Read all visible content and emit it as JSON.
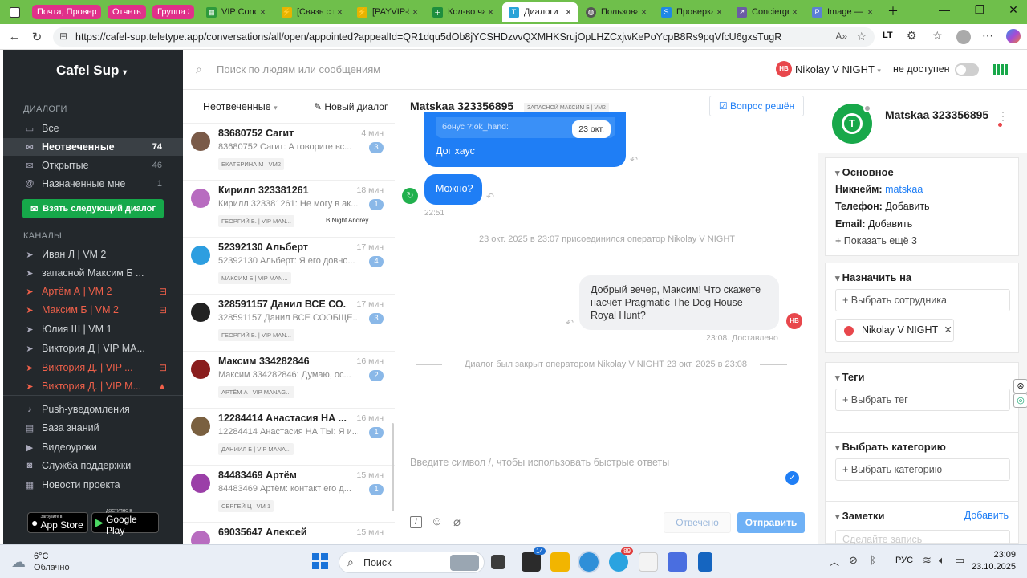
{
  "browser": {
    "tab_groups": [
      {
        "label": "Почта, Проверк",
        "color": "#e0318a"
      },
      {
        "label": "Отчеты",
        "color": "#e0318a"
      },
      {
        "label": "Группа 3",
        "color": "#e0318a"
      }
    ],
    "tabs": [
      {
        "label": "VIP Concie"
      },
      {
        "label": "[Связь с к"
      },
      {
        "label": "[PAYVIP-5"
      },
      {
        "label": "Кол-во ча"
      },
      {
        "label": "Диалоги",
        "active": true
      },
      {
        "label": "Пользова"
      },
      {
        "label": "Проверка"
      },
      {
        "label": "Concierge"
      },
      {
        "label": "Image —"
      }
    ],
    "url": "https://cafel-sup.teletype.app/conversations/all/open/appointed?appealId=QR1dqu5dOb8jYCSHDzvvQXMHKSrujOpLHZCxjwKePoYcpB8Rs9pqVfcU6gxsTugR"
  },
  "sidebar": {
    "brand": "Cafel Sup",
    "dialogs_header": "ДИАЛОГИ",
    "dialog_items": [
      {
        "label": "Все",
        "count": ""
      },
      {
        "label": "Неотвеченные",
        "count": "74",
        "selected": true
      },
      {
        "label": "Открытые",
        "count": "46"
      },
      {
        "label": "Назначенные мне",
        "count": "1"
      }
    ],
    "next_button": "Взять следующий диалог",
    "channels_header": "КАНАЛЫ",
    "channels": [
      {
        "label": "Иван Л | VM 2",
        "red": false
      },
      {
        "label": "запасной Максим Б ...",
        "red": false
      },
      {
        "label": "Артём А | VM 2",
        "red": true
      },
      {
        "label": "Максим Б | VM 2",
        "red": true
      },
      {
        "label": "Юлия Ш | VM 1",
        "red": false
      },
      {
        "label": "Виктория Д | VIP MA...",
        "red": false
      },
      {
        "label": "Виктория Д. | VIP ...",
        "red": true
      },
      {
        "label": "Виктория Д. | VIP M...",
        "red": true
      }
    ],
    "links": [
      "Push-уведомления",
      "База знаний",
      "Видеоуроки",
      "Служба поддержки",
      "Новости проекта"
    ],
    "app_store": {
      "small": "Загрузите в",
      "label": "App Store"
    },
    "google_play": {
      "small": "ДОСТУПНО В",
      "label": "Google Play"
    }
  },
  "header": {
    "search_placeholder": "Поиск по людям или сообщениям",
    "operator_initials": "НВ",
    "operator_name": "Nikolay V NIGHT",
    "status": "не доступен"
  },
  "list": {
    "filter": "Неотвеченные",
    "new_dialog": "Новый диалог",
    "items": [
      {
        "name": "83680752 Сагит",
        "time": "4 мин",
        "preview": "83680752 Сагит: А говорите вс...",
        "badge": "3",
        "tag": "ЕКАТЕРИНА М | VM2",
        "avc": "#7a5a48"
      },
      {
        "name": "Кирилл 323381261",
        "time": "18 мин",
        "preview": "Кирилл 323381261: Не могу в ак...",
        "badge": "1",
        "tag": "ГЕОРГИЙ Б. | VIP MAN...",
        "extra": "B Night Andrey",
        "avc": "#b86cc0"
      },
      {
        "name": "52392130 Альберт",
        "time": "17 мин",
        "preview": "52392130 Альберт: Я его довно...",
        "badge": "4",
        "tag": "МАКСИМ Б | VIP MAN...",
        "avc": "#2d9ee0"
      },
      {
        "name": "328591157 Данил ВСЕ СО...",
        "time": "17 мин",
        "preview": "328591157 Данил ВСЕ СООБЩЕ...",
        "badge": "3",
        "tag": "ГЕОРГИЙ Б. | VIP MAN...",
        "avc": "#222222"
      },
      {
        "name": "Максим 334282846",
        "time": "16 мин",
        "preview": "Максим 334282846: Думаю, ос...",
        "badge": "2",
        "tag": "АРТЁМ А | VIP MANAG...",
        "avc": "#8a1e1e"
      },
      {
        "name": "12284414 Анастасия НА ...",
        "time": "16 мин",
        "preview": "12284414 Анастасия НА ТЫ: Я и...",
        "badge": "1",
        "tag": "ДАНИИЛ Б | VIP MANA...",
        "avc": "#7a6040"
      },
      {
        "name": "84483469 Артём",
        "time": "15 мин",
        "preview": "84483469 Артём: контакт его д...",
        "badge": "1",
        "tag": "СЕРГЕЙ Ц | VM 1",
        "avc": "#9b3fa8"
      },
      {
        "name": "69035647 Алексей",
        "time": "15 мин",
        "preview": "",
        "badge": "",
        "tag": "",
        "avc": "#b86cc0"
      }
    ]
  },
  "chat": {
    "title": "Matskaa 323356895",
    "channel_tag": "ЗАПАСНОЙ МАКСИМ Б | VM2",
    "resolve_button": "Вопрос решён",
    "quoted_text": "бонус ?:ok_hand:",
    "quoted_date": "23 окт.",
    "msg1": "Дог хаус",
    "msg2": "Можно?",
    "msg2_time": "22:51",
    "joined_notice": "23 окт. 2025 в 23:07 присоединился оператор Nikolay V NIGHT",
    "outgoing": "Добрый вечер, Максим! Что скажете насчёт Pragmatic The Dog House — Royal Hunt?",
    "outgoing_initials": "НВ",
    "outgoing_meta": "23:08. Доставлено",
    "closed_notice": "Диалог был закрыт оператором Nikolay V NIGHT 23 окт. 2025 в 23:08",
    "input_placeholder": "Введите символ /, чтобы использовать быстрые ответы",
    "answered_button": "Отвечено",
    "send_button": "Отправить"
  },
  "profile": {
    "name": "Matskaa 323356895",
    "basic_header": "Основное",
    "nickname_label": "Никнейм:",
    "nickname_value": "matskaa",
    "phone_label": "Телефон:",
    "phone_value": "Добавить",
    "email_label": "Email:",
    "email_value": "Добавить",
    "show_more": "Показать ещё 3",
    "assign_header": "Назначить на",
    "assign_placeholder": "+ Выбрать сотрудника",
    "assignee": "Nikolay V NIGHT",
    "tags_header": "Теги",
    "tags_placeholder": "+ Выбрать тег",
    "category_header": "Выбрать категорию",
    "category_placeholder": "+ Выбрать категорию",
    "notes_header": "Заметки",
    "notes_add": "Добавить",
    "notes_placeholder": "Сделайте запись"
  },
  "taskbar": {
    "weather_temp": "6°C",
    "weather_text": "Облачно",
    "search": "Поиск",
    "lang": "РУС",
    "time": "23:09",
    "date": "23.10.2025",
    "badge_telegram": "89",
    "badge_mail": "14"
  }
}
